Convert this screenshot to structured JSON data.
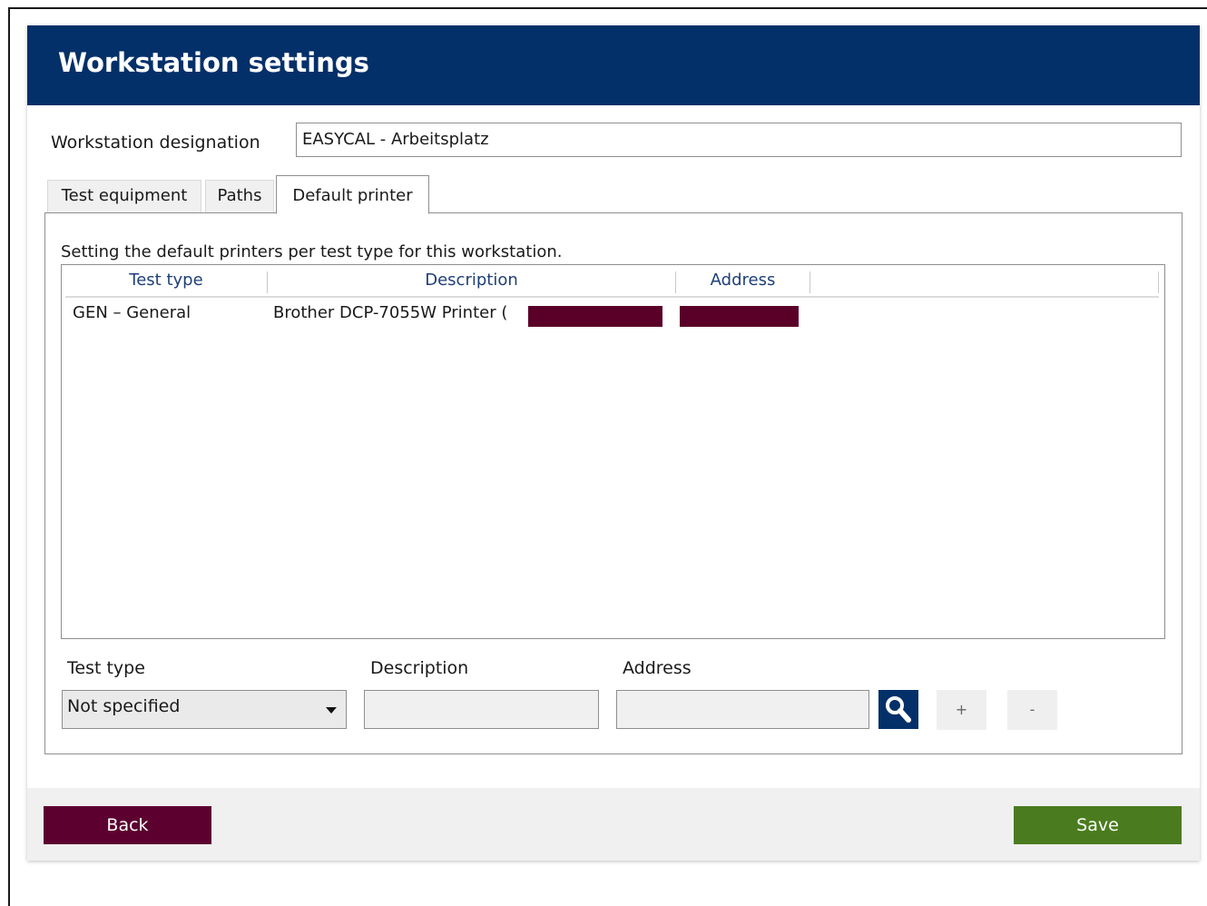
{
  "window": {
    "title": "Workstation settings"
  },
  "designation": {
    "label": "Workstation designation",
    "value": "EASYCAL - Arbeitsplatz"
  },
  "tabs": [
    {
      "label": "Test equipment",
      "active": false
    },
    {
      "label": "Paths",
      "active": false
    },
    {
      "label": "Default printer",
      "active": true
    }
  ],
  "panel": {
    "description": "Setting the default printers per test type for this workstation.",
    "columns": [
      "Test type",
      "Description",
      "Address"
    ],
    "rows": [
      {
        "test_type": "GEN – General",
        "description": "Brother DCP-7055W Printer (",
        "address": ""
      }
    ]
  },
  "form": {
    "test_type_label": "Test type",
    "test_type_value": "Not specified",
    "description_label": "Description",
    "description_value": "",
    "address_label": "Address",
    "address_value": "",
    "search_icon": "magnifier-icon",
    "add_label": "+",
    "remove_label": "-"
  },
  "footer": {
    "back_label": "Back",
    "save_label": "Save"
  },
  "colors": {
    "header": "#033069",
    "back": "#5c0030",
    "save": "#4a7c1f",
    "redaction": "#5a0028"
  }
}
